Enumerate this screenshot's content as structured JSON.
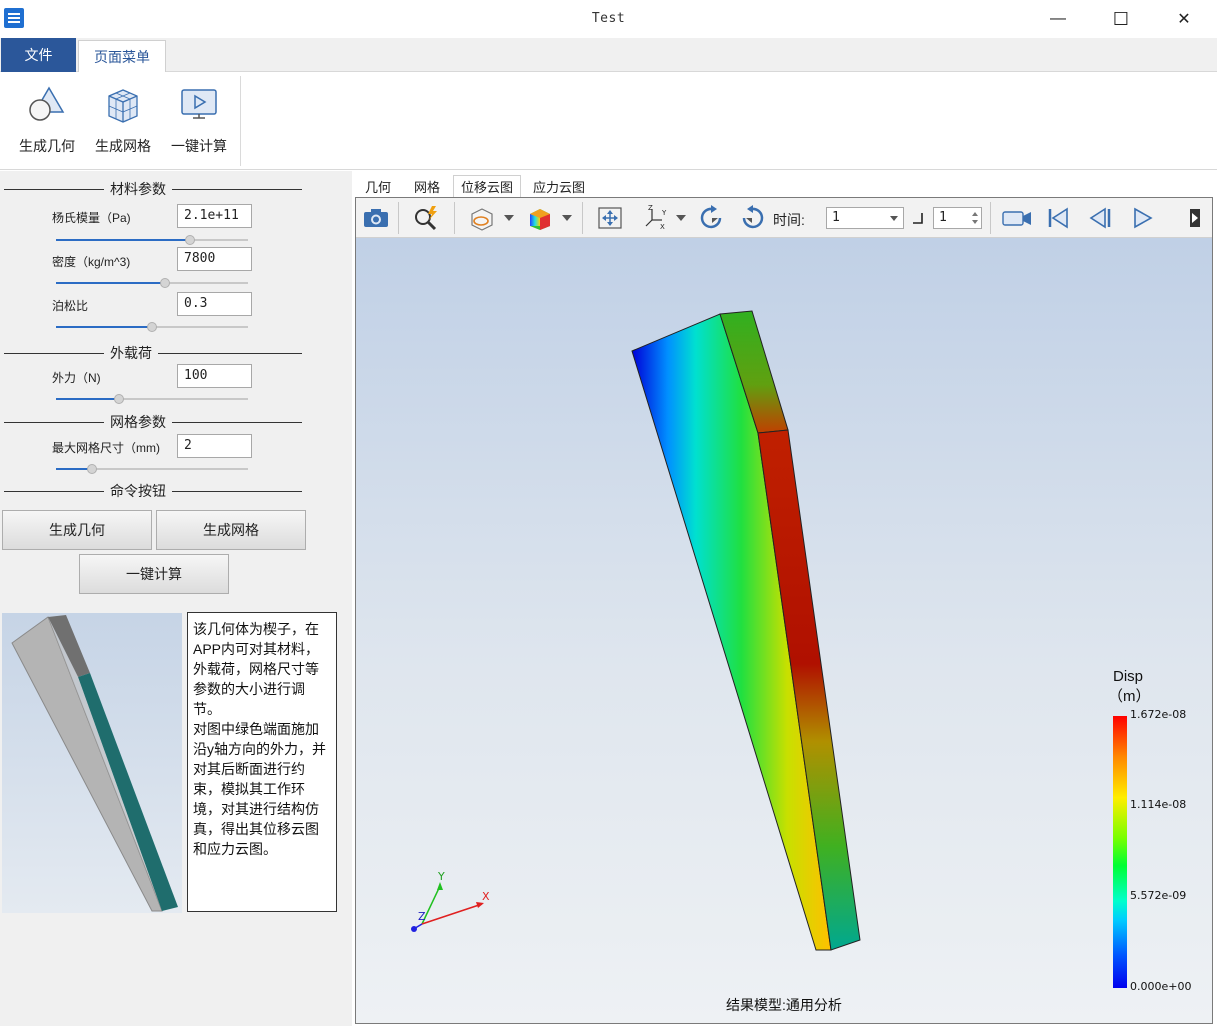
{
  "window": {
    "title": "Test",
    "minimize_glyph": "—",
    "maximize_glyph": "☐",
    "close_glyph": "✕"
  },
  "ribbon": {
    "tabs": [
      {
        "label": "文件"
      },
      {
        "label": "页面菜单"
      }
    ],
    "buttons": [
      {
        "label": "生成几何",
        "icon": "geometry-shapes-icon"
      },
      {
        "label": "生成网格",
        "icon": "mesh-cube-icon"
      },
      {
        "label": "一键计算",
        "icon": "run-monitor-icon"
      }
    ]
  },
  "params": {
    "material_group": "材料参数",
    "youngs_label": "杨氏模量（Pa)",
    "youngs_value": "2.1e+11",
    "youngs_slider": 0.7,
    "density_label": "密度（kg/m^3)",
    "density_value": "7800",
    "density_slider": 0.57,
    "poisson_label": "泊松比",
    "poisson_value": "0.3",
    "poisson_slider": 0.5,
    "load_group": "外载荷",
    "force_label": "外力（N)",
    "force_value": "100",
    "force_slider": 0.33,
    "mesh_group": "网格参数",
    "mesh_label": "最大网格尺寸（mm)",
    "mesh_value": "2",
    "mesh_slider": 0.19,
    "command_group": "命令按钮",
    "btn_geometry": "生成几何",
    "btn_mesh": "生成网格",
    "btn_compute": "一键计算"
  },
  "description": {
    "paragraph1": "该几何体为楔子，在APP内可对其材料，外载荷，网格尺寸等参数的大小进行调节。",
    "paragraph2": "对图中绿色端面施加沿y轴方向的外力，并对其后断面进行约束，模拟其工作环境，对其进行结构仿真，得出其位移云图和应力云图。"
  },
  "viewer": {
    "tabs": [
      {
        "label": "几何"
      },
      {
        "label": "网格"
      },
      {
        "label": "位移云图"
      },
      {
        "label": "应力云图"
      }
    ],
    "active_tab": "位移云图",
    "time_label": "时间:",
    "time_value": "1",
    "step_value": "1",
    "legend": {
      "title_line1": "Disp",
      "title_line2": "（m）",
      "max": "1.672e-08",
      "mid_high": "1.114e-08",
      "mid_low": "5.572e-09",
      "min": "0.000e+00"
    },
    "axes": {
      "x": "X",
      "y": "Y",
      "z": "Z"
    },
    "caption": "结果模型:通用分析"
  },
  "colors": {
    "file_tab": "#2b579a",
    "accent": "#2b6cc4"
  }
}
